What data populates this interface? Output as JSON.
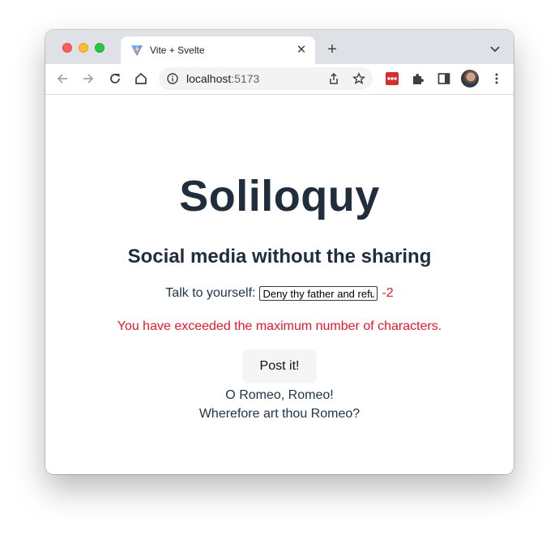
{
  "browser": {
    "tab_title": "Vite + Svelte",
    "url_host": "localhost",
    "url_port": ":5173"
  },
  "app": {
    "title": "Soliloquy",
    "subtitle": "Social media without the sharing",
    "input_label": "Talk to yourself:",
    "input_value": "Deny thy father and refuse thy name",
    "counter": "-2",
    "error_message": "You have exceeded the maximum number of characters.",
    "post_button": "Post it!",
    "posts": [
      "O Romeo, Romeo!",
      "Wherefore art thou Romeo?"
    ]
  },
  "colors": {
    "error": "#e8192c",
    "heading": "#1f2d3d"
  }
}
